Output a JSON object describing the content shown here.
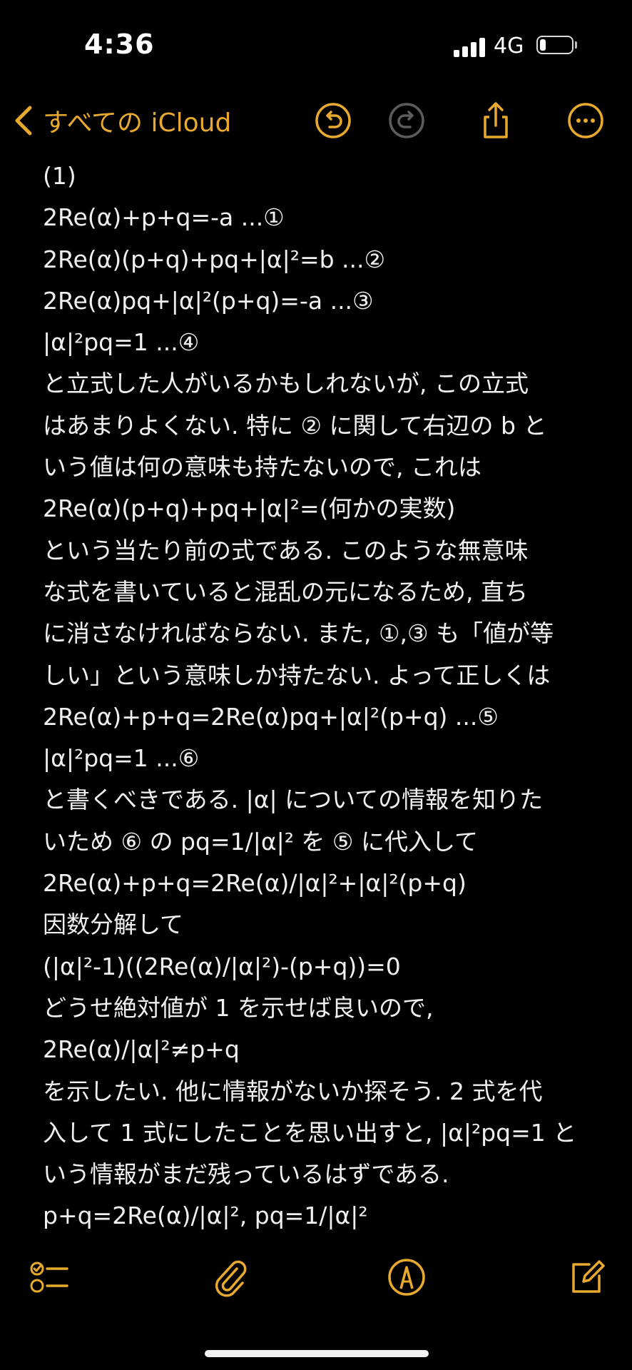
{
  "status_bar": {
    "time": "4:36",
    "network": "4G"
  },
  "nav": {
    "back_label": "すべての iCloud",
    "accent_color": "#e8a92f",
    "icons": [
      "undo-icon",
      "redo-icon",
      "share-icon",
      "more-icon"
    ]
  },
  "note": {
    "lines": [
      "(1)",
      "2Re(α)+p+q=-a ...①",
      "2Re(α)(p+q)+pq+|α|²=b ...②",
      "2Re(α)pq+|α|²(p+q)=-a ...③",
      "|α|²pq=1 ...④",
      "と立式した人がいるかもしれないが, この立式",
      "はあまりよくない. 特に ② に関して右辺の b と",
      "いう値は何の意味も持たないので, これは",
      "2Re(α)(p+q)+pq+|α|²=(何かの実数)",
      "という当たり前の式である. このような無意味",
      "な式を書いていると混乱の元になるため, 直ち",
      "に消さなければならない. また, ①,③ も「値が等",
      "しい」という意味しか持たない. よって正しくは",
      "2Re(α)+p+q=2Re(α)pq+|α|²(p+q) ...⑤",
      "|α|²pq=1 ...⑥",
      "と書くべきである. |α| についての情報を知りた",
      "いため ⑥ の pq=1/|α|² を ⑤ に代入して",
      "2Re(α)+p+q=2Re(α)/|α|²+|α|²(p+q)",
      "因数分解して",
      "(|α|²-1)((2Re(α)/|α|²)-(p+q))=0",
      "どうせ絶対値が 1 を示せば良いので,",
      "2Re(α)/|α|²≠p+q",
      "を示したい. 他に情報がないか探そう. 2 式を代",
      "入して 1 式にしたことを思い出すと, |α|²pq=1 と",
      "いう情報がまだ残っているはずである.",
      "p+q=2Re(α)/|α|², pq=1/|α|²"
    ]
  },
  "toolbar": {
    "icons": [
      "checklist-icon",
      "attachment-icon",
      "markup-icon",
      "compose-icon"
    ]
  }
}
